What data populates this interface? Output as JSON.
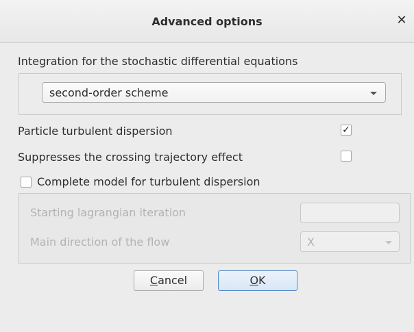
{
  "dialog": {
    "title": "Advanced options",
    "close_icon": "close-icon"
  },
  "integration": {
    "label": "Integration for the stochastic differential equations",
    "scheme_value": "second-order scheme"
  },
  "options": {
    "particle_dispersion_label": "Particle turbulent dispersion",
    "particle_dispersion_checked": true,
    "crossing_trajectory_label": "Suppresses the crossing trajectory effect",
    "crossing_trajectory_checked": false,
    "complete_model_label": "Complete model for turbulent dispersion",
    "complete_model_checked": false
  },
  "complete_model": {
    "starting_iteration_label": "Starting lagrangian iteration",
    "starting_iteration_value": "",
    "main_direction_label": "Main direction of the flow",
    "main_direction_value": "X"
  },
  "buttons": {
    "cancel_mnemonic": "C",
    "cancel_rest": "ancel",
    "ok_mnemonic": "O",
    "ok_rest": "K"
  },
  "colors": {
    "titlebar_bg": "#e7e7e7",
    "dialog_bg": "#ececec",
    "ok_border": "#4f87c7",
    "disabled_text": "#b3b3b3"
  }
}
